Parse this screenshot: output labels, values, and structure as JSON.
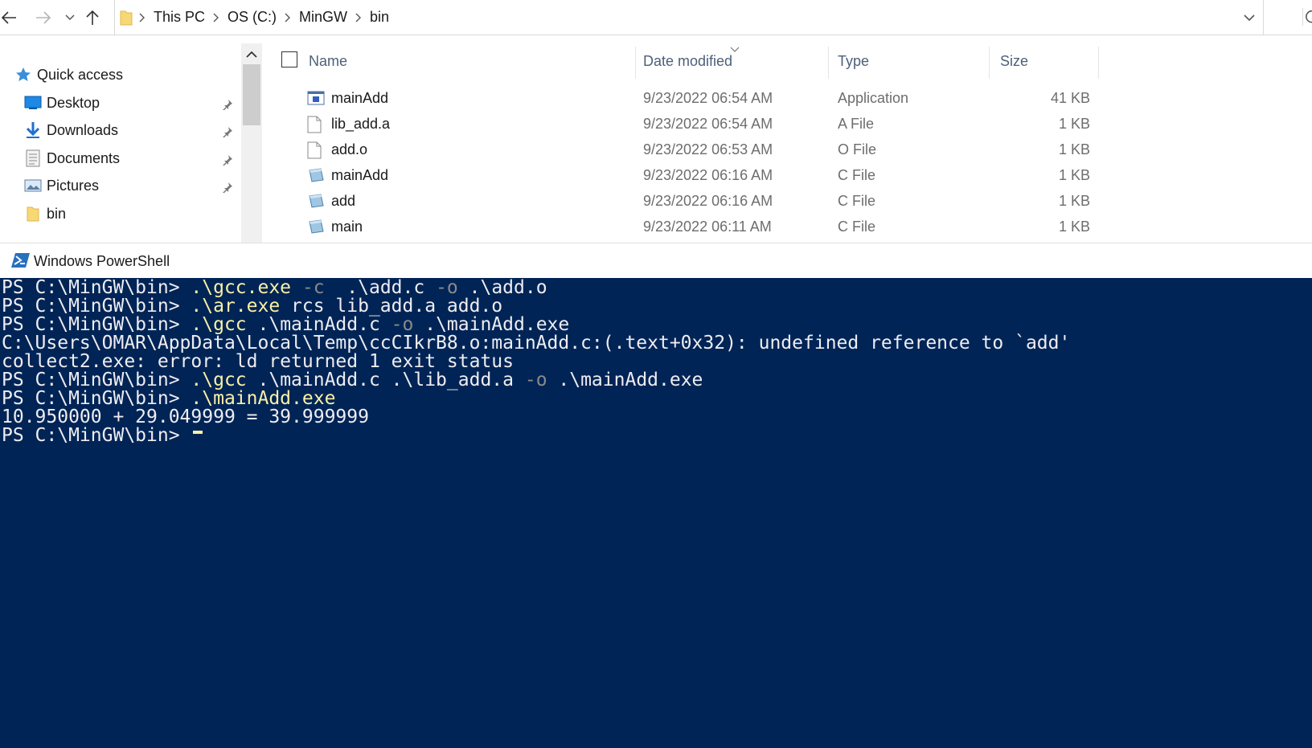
{
  "address_bar": {
    "breadcrumb": [
      "This PC",
      "OS (C:)",
      "MinGW",
      "bin"
    ]
  },
  "nav_pane": {
    "quick_access": "Quick access",
    "items": [
      {
        "label": "Desktop",
        "icon": "desktop-icon",
        "pinned": true
      },
      {
        "label": "Downloads",
        "icon": "downloads-icon",
        "pinned": true
      },
      {
        "label": "Documents",
        "icon": "documents-icon",
        "pinned": true
      },
      {
        "label": "Pictures",
        "icon": "pictures-icon",
        "pinned": true
      },
      {
        "label": "bin",
        "icon": "folder-icon",
        "pinned": false
      }
    ]
  },
  "file_list": {
    "columns": {
      "name": "Name",
      "date": "Date modified",
      "type": "Type",
      "size": "Size"
    },
    "rows": [
      {
        "name": "mainAdd",
        "date": "9/23/2022 06:54 AM",
        "type": "Application",
        "size": "41 KB",
        "icon": "application-icon"
      },
      {
        "name": "lib_add.a",
        "date": "9/23/2022 06:54 AM",
        "type": "A File",
        "size": "1 KB",
        "icon": "file-icon"
      },
      {
        "name": "add.o",
        "date": "9/23/2022 06:53 AM",
        "type": "O File",
        "size": "1 KB",
        "icon": "file-icon"
      },
      {
        "name": "mainAdd",
        "date": "9/23/2022 06:16 AM",
        "type": "C File",
        "size": "1 KB",
        "icon": "c-file-icon"
      },
      {
        "name": "add",
        "date": "9/23/2022 06:16 AM",
        "type": "C File",
        "size": "1 KB",
        "icon": "c-file-icon"
      },
      {
        "name": "main",
        "date": "9/23/2022 06:11 AM",
        "type": "C File",
        "size": "1 KB",
        "icon": "c-file-icon"
      }
    ]
  },
  "powershell": {
    "title": "Windows PowerShell",
    "colors": {
      "background": "#012456",
      "text": "#eeedf0",
      "command": "#f9f1a5",
      "parameter": "#8a8a8a"
    },
    "lines": [
      {
        "parts": [
          {
            "t": "PS C:\\MinGW\\bin> ",
            "k": "plain"
          },
          {
            "t": ".\\gcc.exe",
            "k": "cmd"
          },
          {
            "t": " ",
            "k": "plain"
          },
          {
            "t": "-c",
            "k": "param"
          },
          {
            "t": "  .\\add.c ",
            "k": "plain"
          },
          {
            "t": "-o",
            "k": "param"
          },
          {
            "t": " .\\add.o",
            "k": "plain"
          }
        ]
      },
      {
        "parts": [
          {
            "t": "PS C:\\MinGW\\bin> ",
            "k": "plain"
          },
          {
            "t": ".\\ar.exe",
            "k": "cmd"
          },
          {
            "t": " rcs lib_add.a add.o",
            "k": "plain"
          }
        ]
      },
      {
        "parts": [
          {
            "t": "PS C:\\MinGW\\bin> ",
            "k": "plain"
          },
          {
            "t": ".\\gcc",
            "k": "cmd"
          },
          {
            "t": " .\\mainAdd.c ",
            "k": "plain"
          },
          {
            "t": "-o",
            "k": "param"
          },
          {
            "t": " .\\mainAdd.exe",
            "k": "plain"
          }
        ]
      },
      {
        "parts": [
          {
            "t": "C:\\Users\\OMAR\\AppData\\Local\\Temp\\ccCIkrB8.o:mainAdd.c:(.text+0x32): undefined reference to `add'",
            "k": "plain"
          }
        ]
      },
      {
        "parts": [
          {
            "t": "collect2.exe: error: ld returned 1 exit status",
            "k": "plain"
          }
        ]
      },
      {
        "parts": [
          {
            "t": "PS C:\\MinGW\\bin> ",
            "k": "plain"
          },
          {
            "t": ".\\gcc",
            "k": "cmd"
          },
          {
            "t": " .\\mainAdd.c .\\lib_add.a ",
            "k": "plain"
          },
          {
            "t": "-o",
            "k": "param"
          },
          {
            "t": " .\\mainAdd.exe",
            "k": "plain"
          }
        ]
      },
      {
        "parts": [
          {
            "t": "PS C:\\MinGW\\bin> ",
            "k": "plain"
          },
          {
            "t": ".\\mainAdd.exe",
            "k": "cmd"
          }
        ]
      },
      {
        "parts": [
          {
            "t": "10.950000 + 29.049999 = 39.999999",
            "k": "plain"
          }
        ]
      },
      {
        "parts": [
          {
            "t": "PS C:\\MinGW\\bin> ",
            "k": "plain"
          }
        ]
      }
    ]
  }
}
